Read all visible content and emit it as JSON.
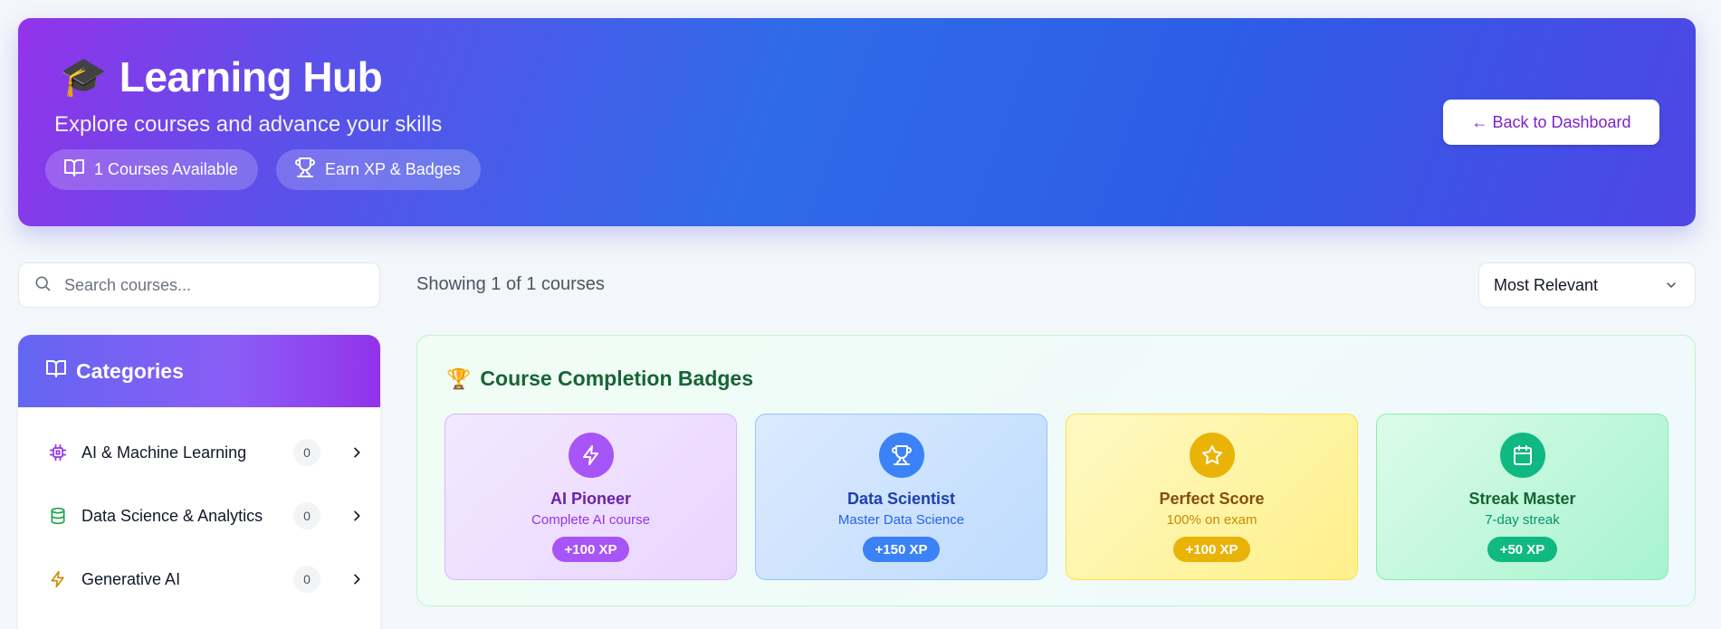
{
  "header": {
    "icon": "graduation-cap-emoji",
    "cap_glyph": "🎓",
    "title": "Learning Hub",
    "subtitle": "Explore courses and advance your skills",
    "pills": [
      {
        "icon": "book-open-icon",
        "label": "1 Courses Available"
      },
      {
        "icon": "trophy-icon",
        "label": "Earn XP & Badges"
      }
    ],
    "back_button": "← Back to Dashboard"
  },
  "search": {
    "placeholder": "Search courses...",
    "value": ""
  },
  "categories": {
    "title": "Categories",
    "items": [
      {
        "icon": "cpu-chip-icon",
        "icon_color": "#9333ea",
        "label": "AI & Machine Learning",
        "count": "0"
      },
      {
        "icon": "database-icon",
        "icon_color": "#16a34a",
        "label": "Data Science & Analytics",
        "count": "0"
      },
      {
        "icon": "lightning-icon",
        "icon_color": "#ca8a04",
        "label": "Generative AI",
        "count": "0"
      }
    ]
  },
  "results": {
    "showing_text": "Showing 1 of 1 courses"
  },
  "sort": {
    "selected": "Most Relevant"
  },
  "badges": {
    "title_glyph": "🏆",
    "title": "Course Completion Badges",
    "items": [
      {
        "icon": "lightning-icon",
        "name": "AI Pioneer",
        "desc": "Complete AI course",
        "xp": "+100 XP"
      },
      {
        "icon": "trophy-icon",
        "name": "Data Scientist",
        "desc": "Master Data Science",
        "xp": "+150 XP"
      },
      {
        "icon": "star-icon",
        "name": "Perfect Score",
        "desc": "100% on exam",
        "xp": "+100 XP"
      },
      {
        "icon": "calendar-icon",
        "name": "Streak Master",
        "desc": "7-day streak",
        "xp": "+50 XP"
      }
    ]
  },
  "colors": {
    "brand_purple": "#9333ea",
    "brand_blue": "#2f6be8",
    "badge_purple": "#a855f7",
    "badge_blue": "#3b82f6",
    "badge_yellow": "#eab308",
    "badge_green": "#10b981"
  }
}
